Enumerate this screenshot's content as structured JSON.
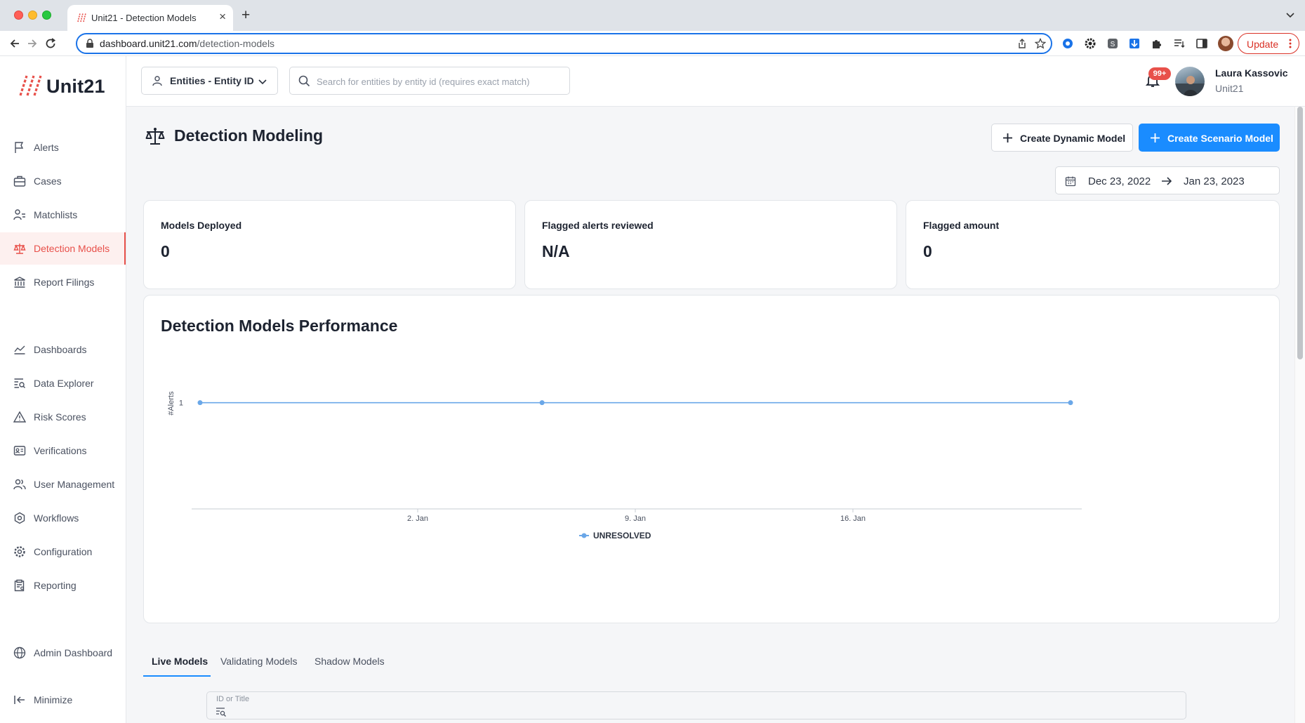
{
  "browser": {
    "tab_title": "Unit21 - Detection Models",
    "tab_close": "×",
    "new_tab": "+",
    "url_host": "dashboard.unit21.com",
    "url_path": "/detection-models",
    "update_label": "Update"
  },
  "app": {
    "logo_text": "Unit21",
    "accent_color": "#e8504a",
    "primary_color": "#1a8cff"
  },
  "sidebar": {
    "items": [
      {
        "label": "Alerts",
        "icon": "flag-icon"
      },
      {
        "label": "Cases",
        "icon": "briefcase-icon"
      },
      {
        "label": "Matchlists",
        "icon": "user-list-icon"
      },
      {
        "label": "Detection Models",
        "icon": "scale-icon",
        "active": true
      },
      {
        "label": "Report Filings",
        "icon": "bank-icon"
      },
      {
        "label": "Dashboards",
        "icon": "line-chart-icon"
      },
      {
        "label": "Data Explorer",
        "icon": "data-search-icon"
      },
      {
        "label": "Risk Scores",
        "icon": "warning-icon"
      },
      {
        "label": "Verifications",
        "icon": "id-card-icon"
      },
      {
        "label": "User Management",
        "icon": "users-icon"
      },
      {
        "label": "Workflows",
        "icon": "workflow-icon"
      },
      {
        "label": "Configuration",
        "icon": "gear-icon"
      },
      {
        "label": "Reporting",
        "icon": "report-icon"
      },
      {
        "label": "Admin Dashboard",
        "icon": "globe-icon"
      },
      {
        "label": "Minimize",
        "icon": "collapse-icon"
      }
    ]
  },
  "topbar": {
    "entity_select_label": "Entities - Entity ID",
    "search_placeholder": "Search for entities by entity id (requires exact match)",
    "notification_count": "99+",
    "user_name": "Laura Kassovic",
    "user_org": "Unit21"
  },
  "page": {
    "title": "Detection Modeling",
    "create_dynamic_label": "Create Dynamic Model",
    "create_scenario_label": "Create Scenario Model",
    "date_start": "Dec 23, 2022",
    "date_end": "Jan 23, 2023"
  },
  "stats": [
    {
      "label": "Models Deployed",
      "value": "0"
    },
    {
      "label": "Flagged alerts reviewed",
      "value": "N/A"
    },
    {
      "label": "Flagged amount",
      "value": "0"
    }
  ],
  "chart_card": {
    "title": "Detection Models Performance"
  },
  "chart_data": {
    "type": "line",
    "title": "Detection Models Performance",
    "ylabel": "#Alerts",
    "xlabel": "",
    "x_tick_labels": [
      "2. Jan",
      "9. Jan",
      "16. Jan"
    ],
    "x_domain": [
      "2022-12-26",
      "2023-01-23"
    ],
    "y_tick_labels": [
      "1"
    ],
    "ylim": [
      0,
      1.5
    ],
    "legend": "bottom-center",
    "series": [
      {
        "name": "UNRESOLVED",
        "color": "#6aa7e8",
        "points": [
          {
            "x": "2022-12-26",
            "y": 1
          },
          {
            "x": "2023-01-02",
            "y": 1
          },
          {
            "x": "2023-01-09",
            "y": 1
          },
          {
            "x": "2023-01-16",
            "y": 1
          },
          {
            "x": "2023-01-23",
            "y": 1
          }
        ],
        "markers": [
          "2022-12-26",
          "2023-01-06",
          "2023-01-23"
        ]
      }
    ]
  },
  "model_tabs": [
    {
      "label": "Live Models",
      "active": true
    },
    {
      "label": "Validating Models",
      "active": false
    },
    {
      "label": "Shadow Models",
      "active": false
    }
  ],
  "filter": {
    "label": "ID or Title"
  }
}
